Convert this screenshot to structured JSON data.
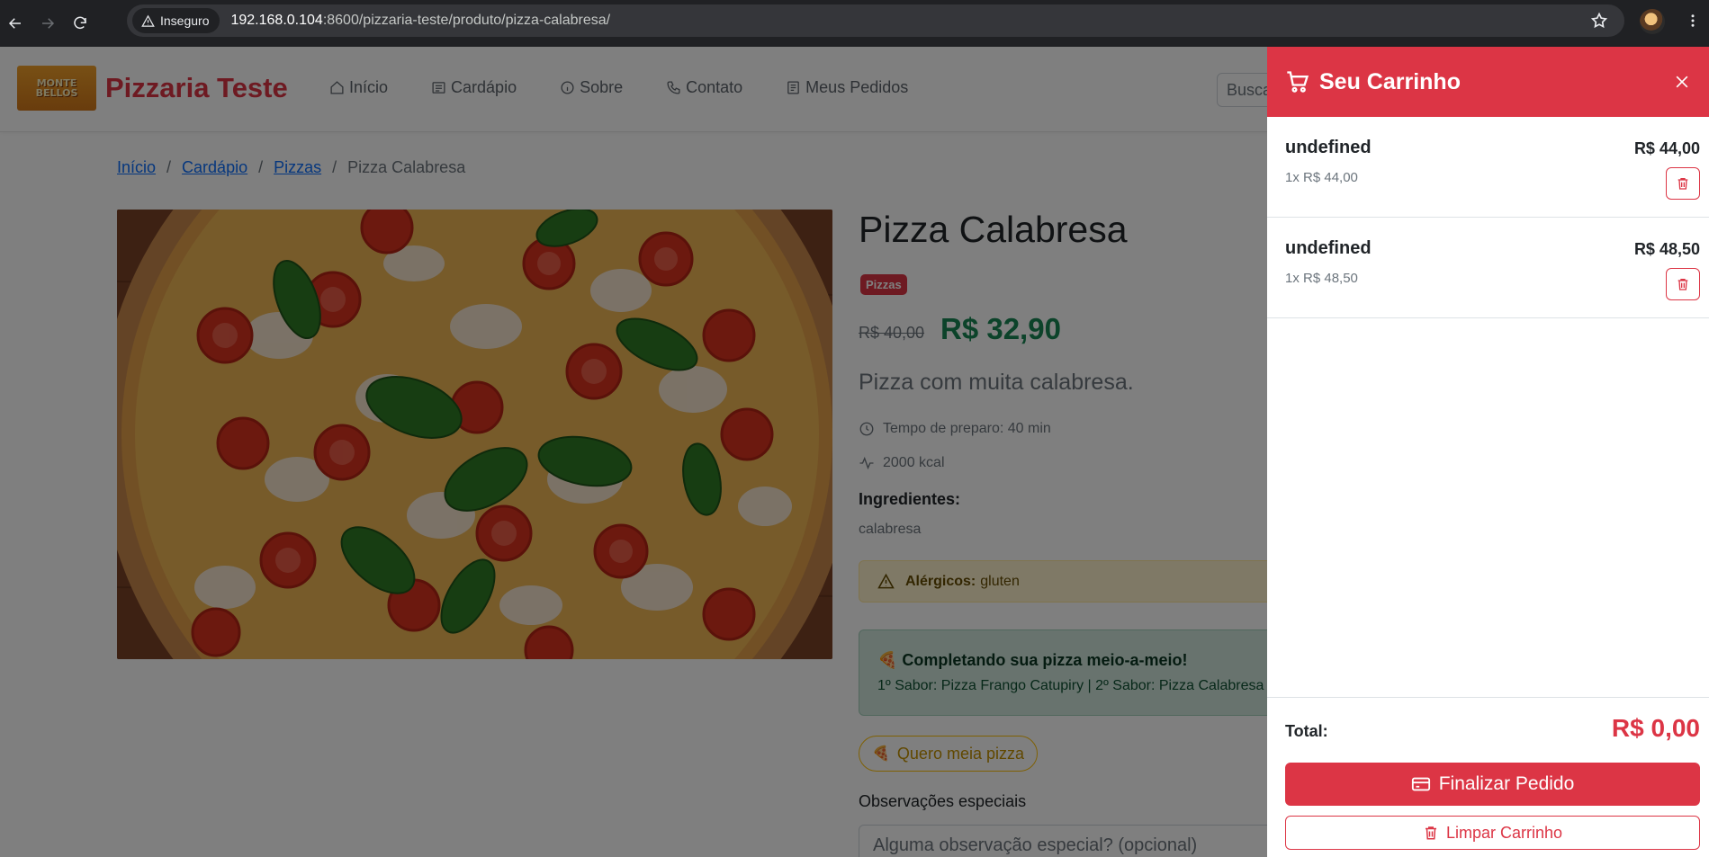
{
  "browser": {
    "security_label": "Inseguro",
    "url_host": "192.168.0.104",
    "url_path": ":8600/pizzaria-teste/produto/pizza-calabresa/"
  },
  "header": {
    "logo_text_line1": "MONTE",
    "logo_text_line2": "BELLOS",
    "brand": "Pizzaria Teste",
    "nav": [
      "Início",
      "Cardápio",
      "Sobre",
      "Contato",
      "Meus Pedidos"
    ],
    "search_placeholder": "Busca"
  },
  "breadcrumb": {
    "items": [
      "Início",
      "Cardápio",
      "Pizzas"
    ],
    "separator": "/",
    "current": "Pizza Calabresa"
  },
  "product": {
    "title": "Pizza Calabresa",
    "category": "Pizzas",
    "old_price": "R$ 40,00",
    "price": "R$ 32,90",
    "description": "Pizza com muita calabresa.",
    "prep_time": "Tempo de preparo: 40 min",
    "calories": "2000 kcal",
    "ingredients_title": "Ingredientes:",
    "ingredients": "calabresa",
    "allergens_label": "Alérgicos:",
    "allergens": "gluten",
    "half_title": "Completando sua pizza meio-a-meio!",
    "half_flavors": "1º Sabor: Pizza Frango Catupiry | 2º Sabor: Pizza Calabresa",
    "half_button": "Quero meia pizza",
    "notes_label": "Observações especiais",
    "notes_placeholder": "Alguma observação especial? (opcional)"
  },
  "cart": {
    "title": "Seu Carrinho",
    "items": [
      {
        "name": "undefined",
        "qty": "1x R$ 44,00",
        "price": "R$ 44,00"
      },
      {
        "name": "undefined",
        "qty": "1x R$ 48,50",
        "price": "R$ 48,50"
      }
    ],
    "total_label": "Total:",
    "total_value": "R$ 0,00",
    "finalize_label": "Finalizar Pedido",
    "clear_label": "Limpar Carrinho"
  },
  "colors": {
    "primary": "#dc3545",
    "success": "#198754",
    "warning_bg": "#fff3cd",
    "success_bg": "#d1e7dd"
  },
  "icons": [
    "back-arrow-icon",
    "forward-arrow-icon",
    "reload-icon",
    "warning-triangle-icon",
    "star-icon",
    "kebab-menu-icon",
    "house-icon",
    "menu-book-icon",
    "info-icon",
    "phone-icon",
    "receipt-icon",
    "clock-icon",
    "activity-icon",
    "pizza-icon",
    "cart-icon",
    "close-icon",
    "trash-icon",
    "credit-card-icon"
  ]
}
